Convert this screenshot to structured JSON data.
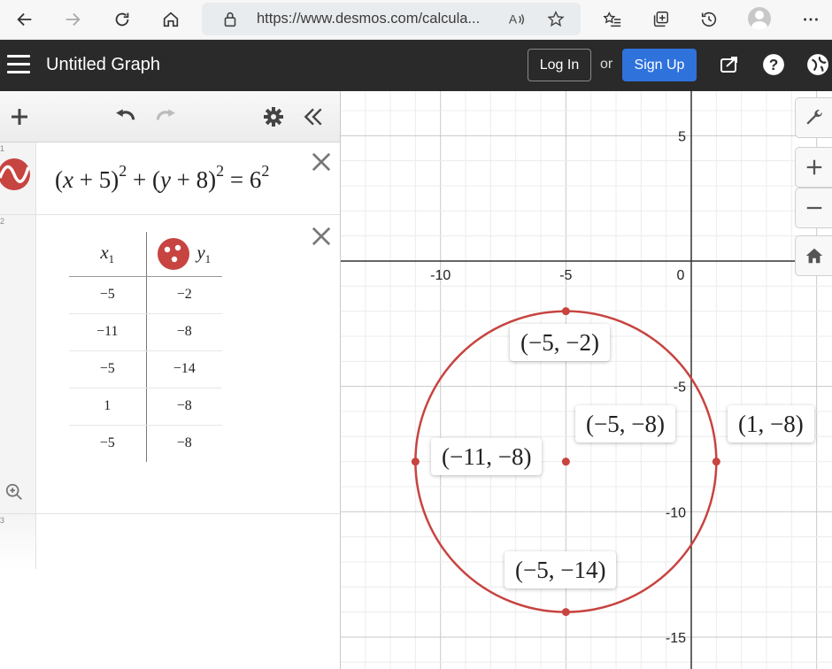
{
  "browser": {
    "url": "https://www.desmos.com/calcula..."
  },
  "header": {
    "title": "Untitled Graph",
    "login_label": "Log In",
    "or_label": "or",
    "signup_label": "Sign Up"
  },
  "expressions": {
    "rows": [
      "1",
      "2",
      "3"
    ],
    "formula": {
      "x": "x",
      "plus5": " + 5",
      "exp2": "2",
      "y": "y",
      "plus8": " + 8",
      "exp2b": "2",
      "eq": " = 6",
      "exp2c": "2"
    },
    "table": {
      "x_header": "x",
      "x_sub": "1",
      "y_header": "y",
      "y_sub": "1",
      "rows": [
        {
          "x": "−5",
          "y": "−2"
        },
        {
          "x": "−11",
          "y": "−8"
        },
        {
          "x": "−5",
          "y": "−14"
        },
        {
          "x": "1",
          "y": "−8"
        },
        {
          "x": "−5",
          "y": "−8"
        }
      ]
    }
  },
  "graph": {
    "x_ticks": [
      "-10",
      "-5",
      "0"
    ],
    "y_ticks": [
      "5",
      "-5",
      "-10",
      "-15"
    ],
    "point_labels": [
      "(−5, −2)",
      "(−5, −8)",
      "(1, −8)",
      "(−11, −8)",
      "(−5, −14)"
    ],
    "points": [
      {
        "x": -5,
        "y": -2
      },
      {
        "x": -11,
        "y": -8
      },
      {
        "x": -5,
        "y": -14
      },
      {
        "x": 1,
        "y": -8
      },
      {
        "x": -5,
        "y": -8
      }
    ],
    "circle": {
      "cx": -5,
      "cy": -8,
      "r": 6
    },
    "curve_color": "#c74440"
  },
  "colors": {
    "accent": "#2f72dc",
    "header_bg": "#2a2a2a",
    "curve": "#c74440"
  }
}
